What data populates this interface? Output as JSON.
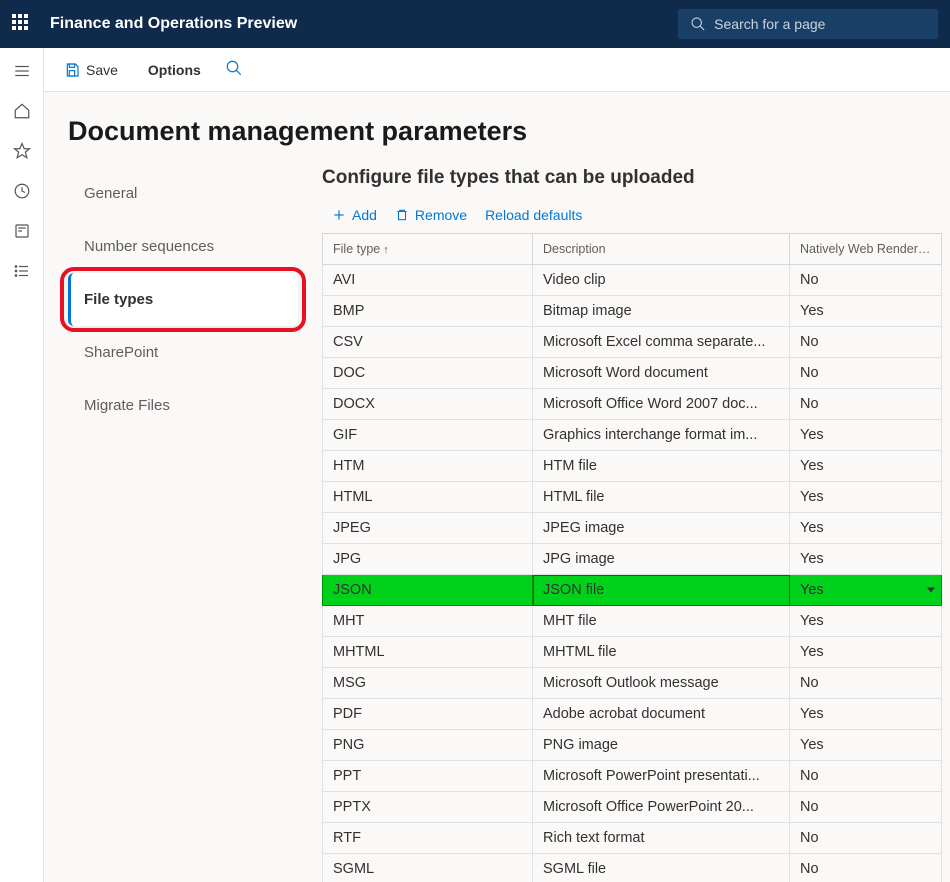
{
  "header": {
    "app_title": "Finance and Operations Preview",
    "search_placeholder": "Search for a page"
  },
  "actionbar": {
    "save_label": "Save",
    "options_label": "Options"
  },
  "page": {
    "title": "Document management parameters"
  },
  "vtabs": {
    "items": [
      {
        "label": "General",
        "active": false
      },
      {
        "label": "Number sequences",
        "active": false
      },
      {
        "label": "File types",
        "active": true
      },
      {
        "label": "SharePoint",
        "active": false
      },
      {
        "label": "Migrate Files",
        "active": false
      }
    ]
  },
  "detail": {
    "title": "Configure file types that can be uploaded",
    "toolbar": {
      "add_label": "Add",
      "remove_label": "Remove",
      "reload_label": "Reload defaults"
    },
    "columns": {
      "filetype": "File type",
      "description": "Description",
      "renderable": "Natively Web Renderable"
    },
    "rows": [
      {
        "ft": "AVI",
        "desc": "Video clip",
        "rend": "No",
        "hl": false
      },
      {
        "ft": "BMP",
        "desc": "Bitmap image",
        "rend": "Yes",
        "hl": false
      },
      {
        "ft": "CSV",
        "desc": "Microsoft Excel comma separate...",
        "rend": "No",
        "hl": false
      },
      {
        "ft": "DOC",
        "desc": "Microsoft Word document",
        "rend": "No",
        "hl": false
      },
      {
        "ft": "DOCX",
        "desc": "Microsoft Office Word 2007 doc...",
        "rend": "No",
        "hl": false
      },
      {
        "ft": "GIF",
        "desc": "Graphics interchange format im...",
        "rend": "Yes",
        "hl": false
      },
      {
        "ft": "HTM",
        "desc": "HTM file",
        "rend": "Yes",
        "hl": false
      },
      {
        "ft": "HTML",
        "desc": "HTML file",
        "rend": "Yes",
        "hl": false
      },
      {
        "ft": "JPEG",
        "desc": "JPEG image",
        "rend": "Yes",
        "hl": false
      },
      {
        "ft": "JPG",
        "desc": "JPG image",
        "rend": "Yes",
        "hl": false
      },
      {
        "ft": "JSON",
        "desc": "JSON file",
        "rend": "Yes",
        "hl": true
      },
      {
        "ft": "MHT",
        "desc": "MHT file",
        "rend": "Yes",
        "hl": false
      },
      {
        "ft": "MHTML",
        "desc": "MHTML file",
        "rend": "Yes",
        "hl": false
      },
      {
        "ft": "MSG",
        "desc": "Microsoft Outlook message",
        "rend": "No",
        "hl": false
      },
      {
        "ft": "PDF",
        "desc": "Adobe acrobat document",
        "rend": "Yes",
        "hl": false
      },
      {
        "ft": "PNG",
        "desc": "PNG image",
        "rend": "Yes",
        "hl": false
      },
      {
        "ft": "PPT",
        "desc": "Microsoft PowerPoint presentati...",
        "rend": "No",
        "hl": false
      },
      {
        "ft": "PPTX",
        "desc": "Microsoft Office PowerPoint 20...",
        "rend": "No",
        "hl": false
      },
      {
        "ft": "RTF",
        "desc": "Rich text format",
        "rend": "No",
        "hl": false
      },
      {
        "ft": "SGML",
        "desc": "SGML file",
        "rend": "No",
        "hl": false
      }
    ]
  },
  "rail": {
    "icons": [
      "menu",
      "home",
      "star",
      "clock",
      "form",
      "list"
    ]
  }
}
